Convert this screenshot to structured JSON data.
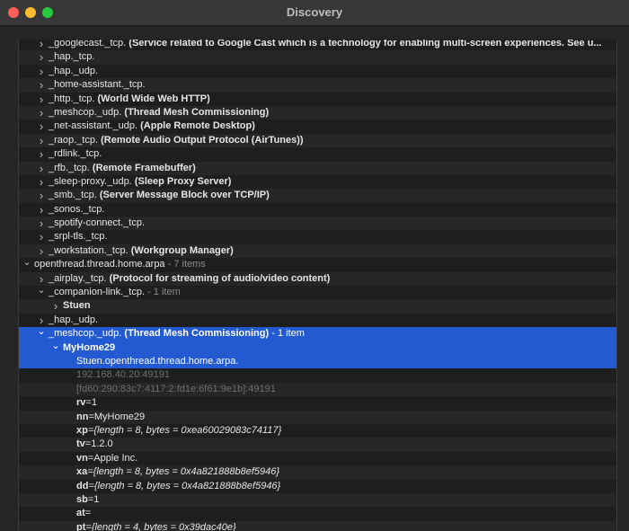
{
  "window": {
    "title": "Discovery"
  },
  "rows": [
    {
      "level": 1,
      "chevron": "right",
      "name": "_googlecast._tcp.",
      "desc": "(Service related to Google Cast which is a technology for enabling multi-screen experiences. See u..."
    },
    {
      "level": 1,
      "chevron": "right",
      "name": "_hap._tcp.",
      "desc": ""
    },
    {
      "level": 1,
      "chevron": "right",
      "name": "_hap._udp.",
      "desc": ""
    },
    {
      "level": 1,
      "chevron": "right",
      "name": "_home-assistant._tcp.",
      "desc": ""
    },
    {
      "level": 1,
      "chevron": "right",
      "name": "_http._tcp.",
      "desc": "(World Wide Web HTTP)"
    },
    {
      "level": 1,
      "chevron": "right",
      "name": "_meshcop._udp.",
      "desc": "(Thread Mesh Commissioning)"
    },
    {
      "level": 1,
      "chevron": "right",
      "name": "_net-assistant._udp.",
      "desc": "(Apple Remote Desktop)"
    },
    {
      "level": 1,
      "chevron": "right",
      "name": "_raop._tcp.",
      "desc": "(Remote Audio Output Protocol (AirTunes))"
    },
    {
      "level": 1,
      "chevron": "right",
      "name": "_rdlink._tcp.",
      "desc": ""
    },
    {
      "level": 1,
      "chevron": "right",
      "name": "_rfb._tcp.",
      "desc": "(Remote Framebuffer)"
    },
    {
      "level": 1,
      "chevron": "right",
      "name": "_sleep-proxy._udp.",
      "desc": "(Sleep Proxy Server)"
    },
    {
      "level": 1,
      "chevron": "right",
      "name": "_smb._tcp.",
      "desc": "(Server Message Block over TCP/IP)"
    },
    {
      "level": 1,
      "chevron": "right",
      "name": "_sonos._tcp.",
      "desc": ""
    },
    {
      "level": 1,
      "chevron": "right",
      "name": "_spotify-connect._tcp.",
      "desc": ""
    },
    {
      "level": 1,
      "chevron": "right",
      "name": "_srpl-tls._tcp.",
      "desc": ""
    },
    {
      "level": 1,
      "chevron": "right",
      "name": "_workstation._tcp.",
      "desc": "(Workgroup Manager)"
    },
    {
      "level": 0,
      "chevron": "down",
      "name": "openthread.thread.home.arpa",
      "count": "- 7 items"
    },
    {
      "level": 1,
      "chevron": "right",
      "name": "_airplay._tcp.",
      "desc": "(Protocol for streaming of audio/video content)"
    },
    {
      "level": 1,
      "chevron": "down",
      "name": "_companion-link._tcp.",
      "count": "- 1 item"
    },
    {
      "level": 2,
      "chevron": "right",
      "host": "Stuen"
    },
    {
      "level": 1,
      "chevron": "right",
      "name": "_hap._udp.",
      "desc": ""
    },
    {
      "level": 1,
      "chevron": "down",
      "name": "_meshcop._udp.",
      "desc": "(Thread Mesh Commissioning)",
      "count": "- 1 item",
      "selected": true
    },
    {
      "level": 2,
      "chevron": "down",
      "host": "MyHome29",
      "selected": true
    },
    {
      "level": 3,
      "plain": "Stuen.openthread.thread.home.arpa.",
      "selected": true
    },
    {
      "level": 3,
      "gray": "192.168.40.20:49191"
    },
    {
      "level": 3,
      "gray": "[fd60:290:83c7:4117:2:fd1e:6f61:9e1b]:49191"
    },
    {
      "level": 3,
      "key": "rv",
      "val": "=1"
    },
    {
      "level": 3,
      "key": "nn",
      "val": "=MyHome29"
    },
    {
      "level": 3,
      "key": "xp",
      "val": "={length = 8, bytes = 0xea60029083c74117}",
      "italic": true
    },
    {
      "level": 3,
      "key": "tv",
      "val": "=1.2.0"
    },
    {
      "level": 3,
      "key": "vn",
      "val": "=Apple Inc."
    },
    {
      "level": 3,
      "key": "xa",
      "val": "={length = 8, bytes = 0x4a821888b8ef5946}",
      "italic": true
    },
    {
      "level": 3,
      "key": "dd",
      "val": "={length = 8, bytes = 0x4a821888b8ef5946}",
      "italic": true
    },
    {
      "level": 3,
      "key": "sb",
      "val": "=1"
    },
    {
      "level": 3,
      "key": "at",
      "val": "="
    },
    {
      "level": 3,
      "key": "pt",
      "val": "={length = 4, bytes = 0x39dac40e}",
      "italic": true
    }
  ]
}
